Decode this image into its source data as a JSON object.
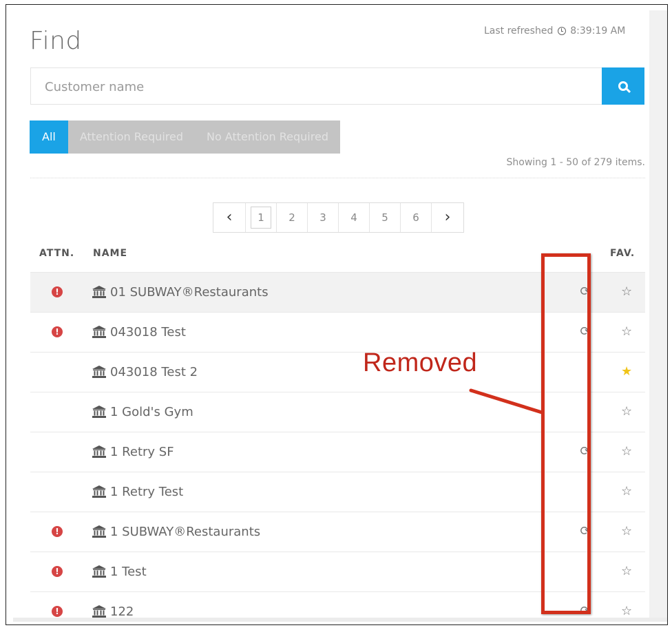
{
  "header": {
    "title": "Find",
    "refresh_label": "Last refreshed",
    "refresh_time": "8:39:19 AM"
  },
  "search": {
    "placeholder": "Customer name",
    "value": "",
    "icon": "search-icon"
  },
  "filters": [
    {
      "label": "All",
      "active": true
    },
    {
      "label": "Attention Required",
      "active": false
    },
    {
      "label": "No Attention Required",
      "active": false
    }
  ],
  "showing_text": "Showing 1 - 50 of 279 items.",
  "pagination": {
    "prev": "‹",
    "next": "›",
    "pages": [
      "1",
      "2",
      "3",
      "4",
      "5",
      "6"
    ],
    "current": "1"
  },
  "table": {
    "headers": {
      "attn": "ATTN.",
      "name": "NAME",
      "fav": "FAV."
    },
    "rows": [
      {
        "name": "01 SUBWAY®Restaurants",
        "attention": true,
        "sync": true,
        "favorite": false
      },
      {
        "name": "043018 Test",
        "attention": true,
        "sync": true,
        "favorite": false
      },
      {
        "name": "043018 Test 2",
        "attention": false,
        "sync": false,
        "favorite": true
      },
      {
        "name": "1 Gold's Gym",
        "attention": false,
        "sync": false,
        "favorite": false
      },
      {
        "name": "1 Retry SF",
        "attention": false,
        "sync": true,
        "favorite": false
      },
      {
        "name": "1 Retry Test",
        "attention": false,
        "sync": false,
        "favorite": false
      },
      {
        "name": "1 SUBWAY®Restaurants",
        "attention": true,
        "sync": true,
        "favorite": false
      },
      {
        "name": "1 Test",
        "attention": true,
        "sync": false,
        "favorite": false
      },
      {
        "name": "122",
        "attention": true,
        "sync": true,
        "favorite": false
      }
    ]
  },
  "annotation": {
    "label": "Removed",
    "color": "#d2301c"
  },
  "colors": {
    "accent": "#1aa3e6",
    "attention": "#d64545",
    "favorite": "#f0c419"
  }
}
